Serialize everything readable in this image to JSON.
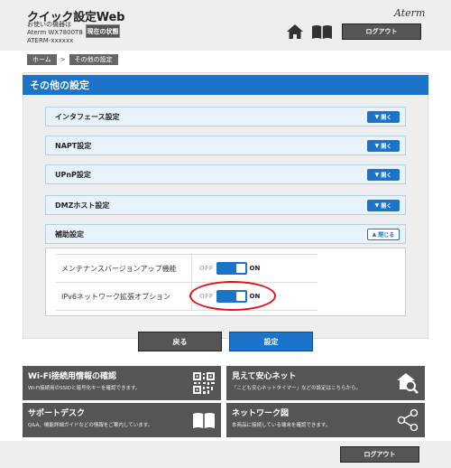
{
  "header": {
    "app_title": "クイック設定Web",
    "device_line1": "お使いの機器は",
    "device_line2": "Aterm WX7800T8",
    "device_line3": "ATERM-xxxxxx",
    "status_button": "現在の状態",
    "brand": "Aterm",
    "logout": "ログアウト"
  },
  "breadcrumb": {
    "home": "ホーム",
    "separator": ">",
    "current": "その他の設定"
  },
  "page_title": "その他の設定",
  "sections": [
    {
      "label": "インタフェース設定",
      "button": "開く"
    },
    {
      "label": "NAPT設定",
      "button": "開く"
    },
    {
      "label": "UPnP設定",
      "button": "開く"
    },
    {
      "label": "DMZホスト設定",
      "button": "開く"
    },
    {
      "label": "補助設定",
      "button": "閉じる"
    }
  ],
  "aux_settings": [
    {
      "label": "メンテナンスバージョンアップ機能",
      "off": "OFF",
      "on": "ON",
      "state": "on"
    },
    {
      "label": "IPv6ネットワーク拡張オプション",
      "off": "OFF",
      "on": "ON",
      "state": "on"
    }
  ],
  "actions": {
    "back": "戻る",
    "apply": "設定"
  },
  "tiles": [
    {
      "title": "Wi-Fi接続用情報の確認",
      "desc": "Wi-Fi接続用のSSIDと暗号化キーを確認できます。",
      "icon": "qr-code-icon"
    },
    {
      "title": "見えて安心ネット",
      "desc": "「こども安心ネットタイマー」などの設定はこちらから。",
      "icon": "house-search-icon"
    },
    {
      "title": "サポートデスク",
      "desc": "Q&A、機能詳細ガイドなどの情報をご案内しています。",
      "icon": "book-icon"
    },
    {
      "title": "ネットワーク図",
      "desc": "本商品に接続している端末を確認できます。",
      "icon": "share-network-icon"
    }
  ],
  "footer": {
    "logout": "ログアウト"
  },
  "colors": {
    "accent": "#1b74c9",
    "dark_button": "#555555",
    "highlight": "#e0141e"
  }
}
